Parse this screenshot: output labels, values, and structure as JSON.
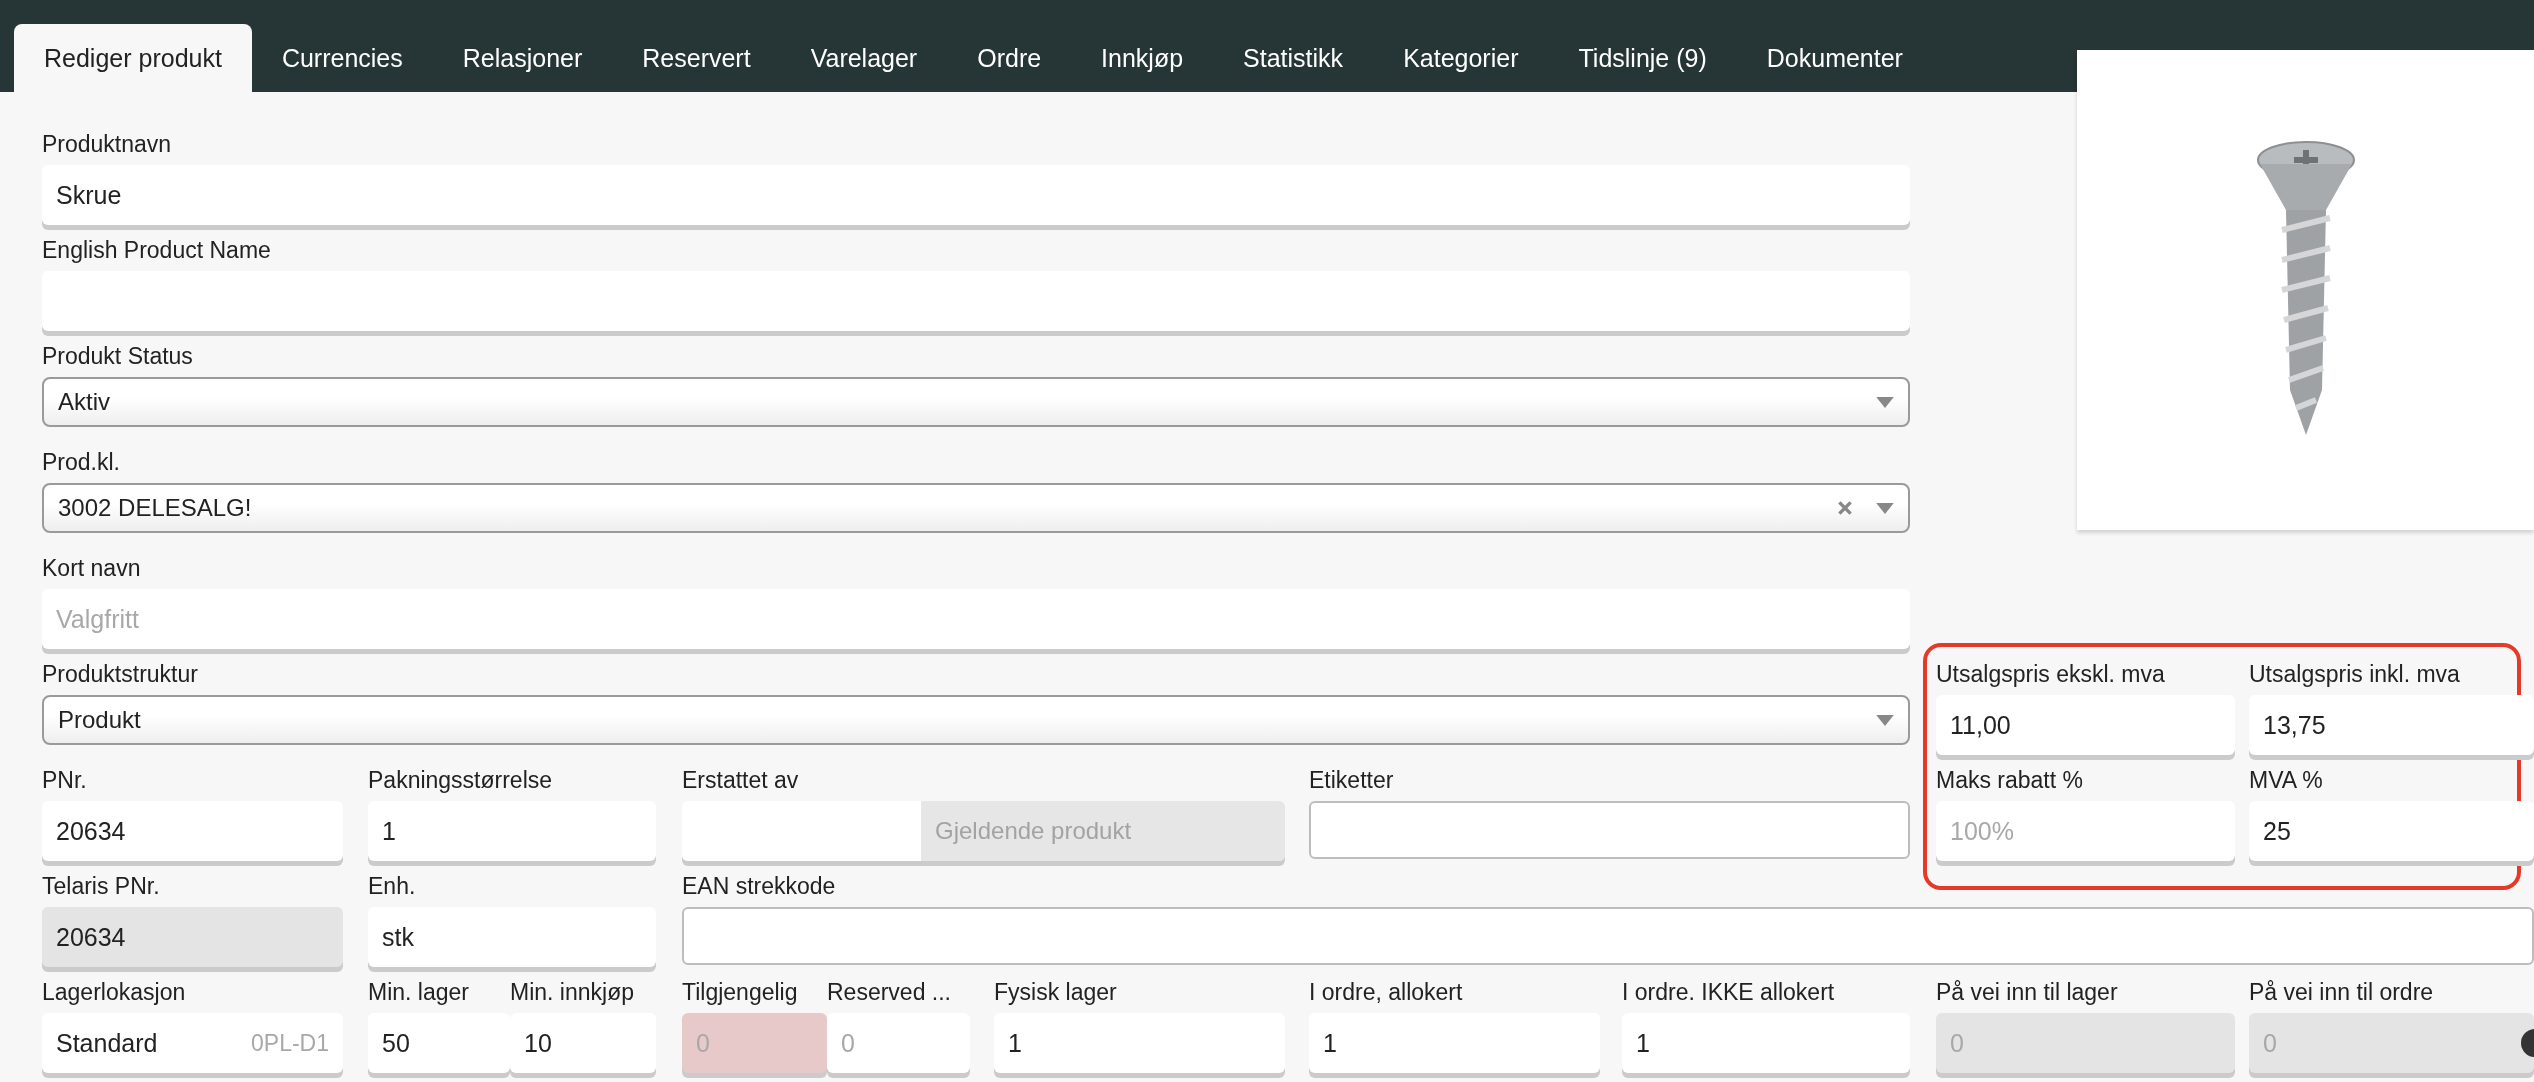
{
  "tabs": [
    {
      "label": "Rediger produkt",
      "selected": true
    },
    {
      "label": "Currencies",
      "selected": false
    },
    {
      "label": "Relasjoner",
      "selected": false
    },
    {
      "label": "Reservert",
      "selected": false
    },
    {
      "label": "Varelager",
      "selected": false
    },
    {
      "label": "Ordre",
      "selected": false
    },
    {
      "label": "Innkjøp",
      "selected": false
    },
    {
      "label": "Statistikk",
      "selected": false
    },
    {
      "label": "Kategorier",
      "selected": false
    },
    {
      "label": "Tidslinje (9)",
      "selected": false
    },
    {
      "label": "Dokumenter",
      "selected": false
    }
  ],
  "main_fields": [
    {
      "label": "Produktnavn",
      "kind": "text",
      "value": "Skrue"
    },
    {
      "label": "English Product Name",
      "kind": "text"
    },
    {
      "label": "Produkt Status",
      "kind": "select",
      "value": "Aktiv"
    },
    {
      "label": "Prod.kl.",
      "kind": "select",
      "value": "3002 DELESALG!",
      "clearable": true
    },
    {
      "label": "Kort navn",
      "kind": "text",
      "placeholder": "Valgfritt"
    }
  ],
  "structure": {
    "label": "Produktstruktur",
    "kind": "select",
    "value": "Produkt"
  },
  "prices": [
    {
      "label": "Utsalgspris ekskl. mva",
      "kind": "text",
      "value": "11,00"
    },
    {
      "label": "Utsalgspris inkl. mva",
      "kind": "text",
      "value": "13,75"
    },
    {
      "label": "Maks rabatt %",
      "kind": "text",
      "placeholder": "100%"
    },
    {
      "label": "MVA %",
      "kind": "text",
      "value": "25"
    }
  ],
  "row_pnr": [
    {
      "label": "PNr.",
      "kind": "text",
      "value": "20634"
    },
    {
      "label": "Pakningsstørrelse",
      "kind": "text",
      "value": "1"
    },
    {
      "label": "Erstattet av",
      "kind": "addon",
      "addon": "Gjeldende produkt"
    },
    {
      "label": "Etiketter",
      "kind": "bordered"
    }
  ],
  "row_telaris": [
    {
      "label": "Telaris PNr.",
      "kind": "text",
      "value": "20634",
      "disabled": true
    },
    {
      "label": "Enh.",
      "kind": "text",
      "value": "stk"
    },
    {
      "label": "EAN strekkode",
      "kind": "bordered"
    }
  ],
  "row_stock": [
    {
      "label": "Lagerlokasjon",
      "kind": "location",
      "value": "Standard",
      "code": "0PL-D1"
    },
    {
      "label": "Min. lager",
      "kind": "text",
      "value": "50"
    },
    {
      "label": "Min. innkjøp",
      "kind": "text",
      "value": "10"
    },
    {
      "label": "Tilgjengelig",
      "kind": "text",
      "placeholder": "0",
      "warning": true
    },
    {
      "label": "Reserved ...",
      "kind": "text",
      "placeholder": "0"
    },
    {
      "label": "Fysisk lager",
      "kind": "text",
      "value": "1"
    },
    {
      "label": "I ordre, allokert",
      "kind": "text",
      "value": "1"
    },
    {
      "label": "I ordre. IKKE allokert",
      "kind": "text",
      "value": "1"
    },
    {
      "label": "På vei inn til lager",
      "kind": "text",
      "placeholder": "0",
      "disabled": true
    },
    {
      "label": "På vei inn til ordre",
      "kind": "text",
      "placeholder": "0",
      "disabled": true,
      "info_icon": true
    }
  ]
}
